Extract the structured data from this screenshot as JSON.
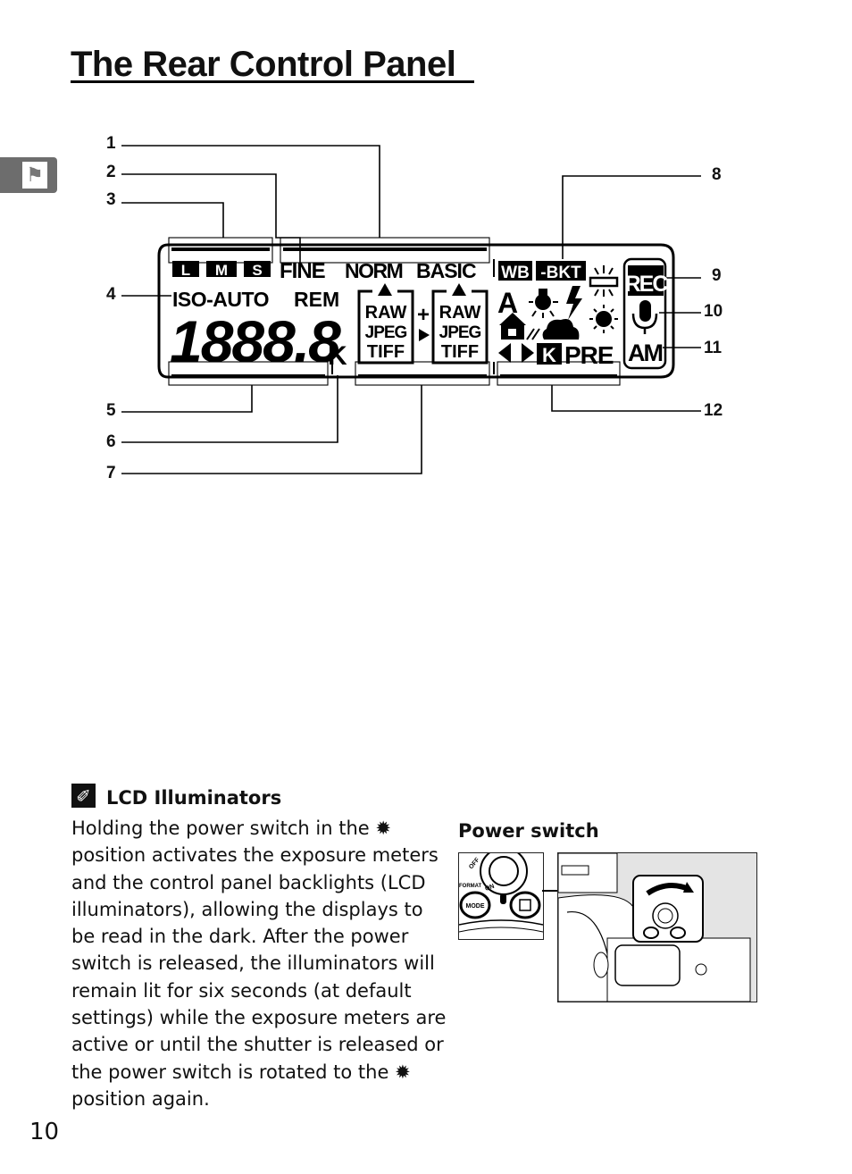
{
  "page": {
    "title": "The Rear Control Panel",
    "page_number": "10",
    "side_tab_icon": "weathervane-rooster-icon"
  },
  "diagram": {
    "callouts": [
      "1",
      "2",
      "3",
      "4",
      "5",
      "6",
      "7",
      "8",
      "9",
      "10",
      "11",
      "12"
    ],
    "lcd": {
      "size_boxes": [
        "L",
        "M",
        "S"
      ],
      "quality": [
        "FINE",
        "NORM",
        "BASIC"
      ],
      "iso_auto": "ISO-AUTO",
      "rem": "REM",
      "digits": "1888.8",
      "k": "K",
      "format_left": [
        "RAW",
        "JPEG",
        "TIFF"
      ],
      "format_right": [
        "RAW",
        "JPEG",
        "TIFF"
      ],
      "plus": "+",
      "wb": "WB",
      "bkt": "-BKT",
      "auto_a": "A",
      "k_box": "K",
      "pre": "PRE",
      "rec": "REC",
      "am": "AM"
    }
  },
  "note": {
    "icon": "paperclip-note-icon",
    "title": "LCD Illuminators",
    "body": "Holding the power switch in the ✹\nposition activates the exposure meters\nand the control panel backlights (LCD\nilluminators), allowing the displays to\nbe read in the dark.  After the power\nswitch is released, the illuminators will\nremain lit for six seconds (at default\nsettings) while the exposure meters are\nactive or until the shutter is released or\nthe power switch is rotated to the ✹\nposition again."
  },
  "power_switch": {
    "title": "Power switch",
    "photo_labels": {
      "off": "OFF",
      "on": "ON",
      "mode": "MODE",
      "format": "FORMAT"
    }
  }
}
